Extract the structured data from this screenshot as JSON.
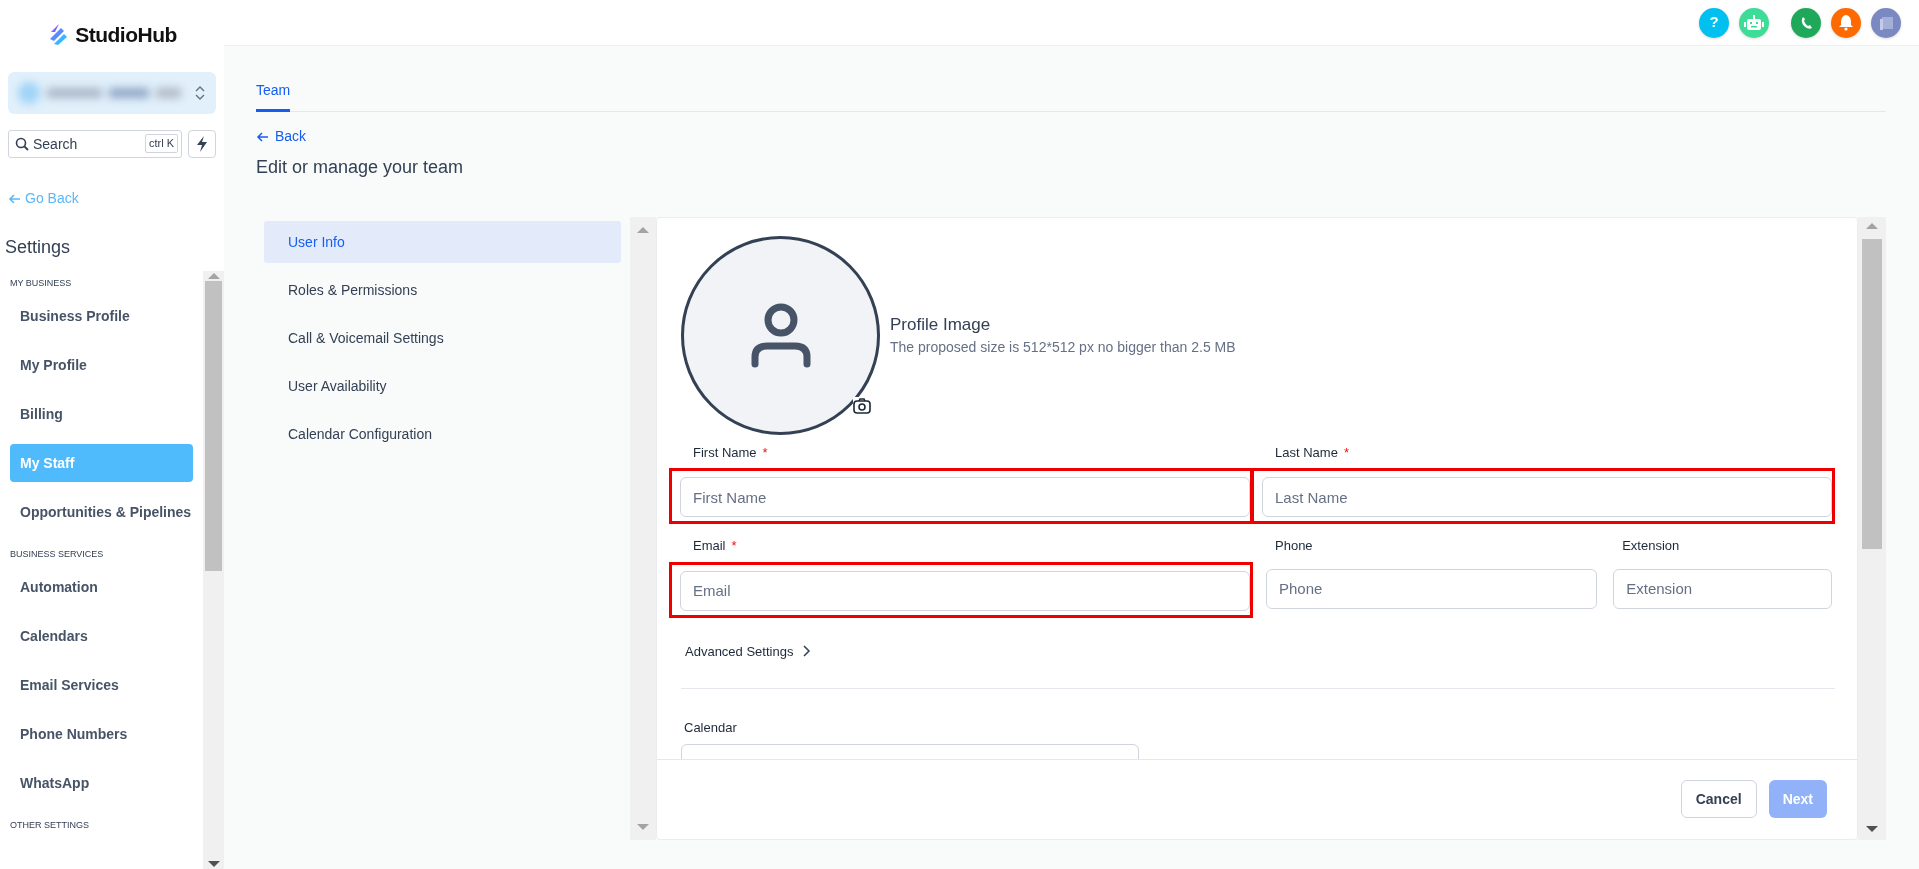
{
  "brand": {
    "name": "StudioHub"
  },
  "search": {
    "placeholder": "Search",
    "shortcut": "ctrl K"
  },
  "topbar": {
    "help": "?"
  },
  "sidebar": {
    "back": "Go Back",
    "title": "Settings",
    "sections": [
      {
        "heading": "MY BUSINESS",
        "items": [
          {
            "label": "Business Profile",
            "selected": false
          },
          {
            "label": "My Profile",
            "selected": false
          },
          {
            "label": "Billing",
            "selected": false
          },
          {
            "label": "My Staff",
            "selected": true
          },
          {
            "label": "Opportunities & Pipelines",
            "selected": false
          }
        ]
      },
      {
        "heading": "BUSINESS SERVICES",
        "items": [
          {
            "label": "Automation",
            "selected": false
          },
          {
            "label": "Calendars",
            "selected": false
          },
          {
            "label": "Email Services",
            "selected": false
          },
          {
            "label": "Phone Numbers",
            "selected": false
          },
          {
            "label": "WhatsApp",
            "selected": false
          }
        ]
      },
      {
        "heading": "OTHER SETTINGS"
      }
    ]
  },
  "tabs": [
    {
      "label": "Team",
      "selected": true
    }
  ],
  "back": "Back",
  "heading": "Edit or manage your team",
  "steps": [
    {
      "label": "User Info",
      "selected": true
    },
    {
      "label": "Roles & Permissions",
      "selected": false
    },
    {
      "label": "Call & Voicemail Settings",
      "selected": false
    },
    {
      "label": "User Availability",
      "selected": false
    },
    {
      "label": "Calendar Configuration",
      "selected": false
    }
  ],
  "profile": {
    "title": "Profile Image",
    "hint": "The proposed size is 512*512 px no bigger than 2.5 MB"
  },
  "field_rows": [
    [
      {
        "label": "First Name",
        "required_mark": "*",
        "placeholder": "First Name",
        "highlighted": true
      },
      {
        "label": "Last Name",
        "required_mark": "*",
        "placeholder": "Last Name",
        "highlighted": true
      }
    ],
    [
      {
        "label": "Email",
        "required_mark": "*",
        "placeholder": "Email",
        "highlighted": true
      },
      {
        "label": "Phone",
        "placeholder": "Phone",
        "highlighted": false
      },
      {
        "label": "Extension",
        "placeholder": "Extension",
        "highlighted": false
      }
    ]
  ],
  "advanced": {
    "label": "Advanced Settings",
    "expanded": false
  },
  "calendar": {
    "label": "Calendar"
  },
  "buttons": [
    {
      "label": "Cancel",
      "kind": "secondary",
      "disabled": false
    },
    {
      "label": "Next",
      "kind": "primary",
      "disabled": true
    }
  ]
}
